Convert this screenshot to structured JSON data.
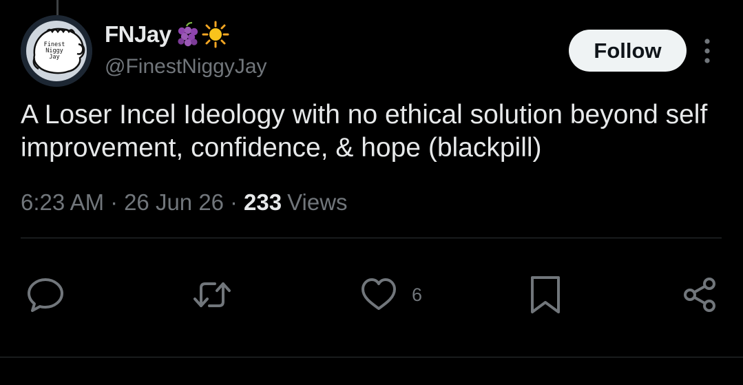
{
  "author": {
    "display_name": "FNJay",
    "handle": "@FinestNiggyJay",
    "avatar_lines": [
      "Finest",
      "Niggy",
      "Jay"
    ],
    "name_emojis": [
      "grapes-icon",
      "sun-icon"
    ]
  },
  "follow_label": "Follow",
  "tweet": {
    "text": "A Loser Incel Ideology with no ethical solution beyond self improvement, confidence, & hope (blackpill)"
  },
  "meta": {
    "time": "6:23 AM",
    "separator": "·",
    "date": "26 Jun 26",
    "views_count": "233",
    "views_label": "Views"
  },
  "actions": {
    "reply_icon": "speech-bubble-icon",
    "retweet_icon": "repost-arrows-icon",
    "like_icon": "heart-icon",
    "like_count": "6",
    "bookmark_icon": "bookmark-icon",
    "share_icon": "share-icon"
  },
  "colors": {
    "background": "#000000",
    "text_primary": "#e7e9ea",
    "text_secondary": "#71767b",
    "divider": "#2f3336",
    "follow_bg": "#eff3f4"
  }
}
